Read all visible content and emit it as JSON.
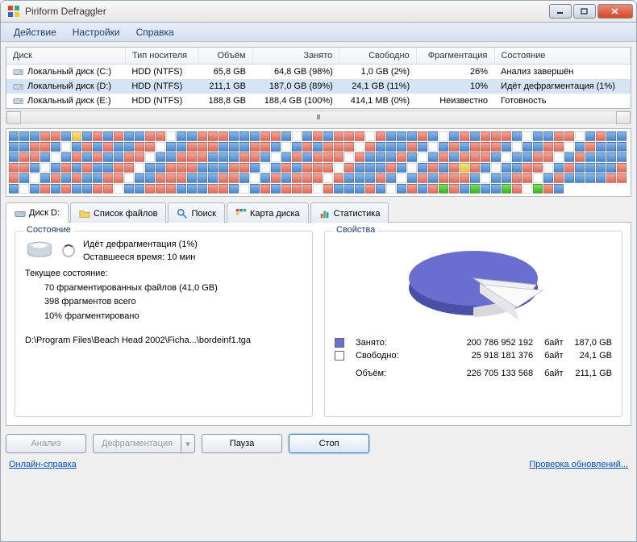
{
  "window": {
    "title": "Piriform Defraggler"
  },
  "menu": {
    "action": "Действие",
    "settings": "Настройки",
    "help": "Справка"
  },
  "disk_table": {
    "headers": {
      "disk": "Диск",
      "media": "Тип носителя",
      "size": "Объём",
      "used": "Занято",
      "free": "Свободно",
      "frag": "Фрагментация",
      "state": "Состояние"
    },
    "rows": [
      {
        "name": "Локальный диск (C:)",
        "media": "HDD (NTFS)",
        "size": "65,8 GB",
        "used": "64,8 GB (98%)",
        "free": "1,0 GB (2%)",
        "frag": "26%",
        "state": "Анализ завершён"
      },
      {
        "name": "Локальный диск (D:)",
        "media": "HDD (NTFS)",
        "size": "211,1 GB",
        "used": "187,0 GB (89%)",
        "free": "24,1 GB (11%)",
        "frag": "10%",
        "state": "Идёт дефрагментация (1%)"
      },
      {
        "name": "Локальный диск (E:)",
        "media": "HDD (NTFS)",
        "size": "188,8 GB",
        "used": "188,4 GB (100%)",
        "free": "414,1 MB (0%)",
        "frag": "Неизвестно",
        "state": "Готовность"
      }
    ]
  },
  "tabs": {
    "disk": "Диск D:",
    "file_list": "Список файлов",
    "search": "Поиск",
    "map": "Карта диска",
    "stats": "Статистика"
  },
  "status_panel": {
    "title": "Состояние",
    "running": "Идёт дефрагментация (1%)",
    "eta": "Оставшееся время: 10 мин",
    "current_label": "Текущее состояние:",
    "line1": "70  фрагментированных файлов (41,0 GB)",
    "line2": "398  фрагментов всего",
    "line3": "10%  фрагментировано",
    "filepath": "D:\\Program Files\\Beach Head 2002\\Ficha...\\bordeinf1.tga"
  },
  "props_panel": {
    "title": "Свойства",
    "used_label": "Занято:",
    "used_bytes": "200 786 952 192",
    "used_unit": "байт",
    "used_gb": "187,0 GB",
    "free_label": "Свободно:",
    "free_bytes": "25 918 181 376",
    "free_unit": "байт",
    "free_gb": "24,1 GB",
    "total_label": "Объём:",
    "total_bytes": "226 705 133 568",
    "total_unit": "байт",
    "total_gb": "211,1 GB"
  },
  "buttons": {
    "analyze": "Анализ",
    "defrag": "Дефрагментация",
    "pause": "Пауза",
    "stop": "Стоп"
  },
  "footer": {
    "online_help": "Онлайн-справка",
    "check_updates": "Проверка обновлений..."
  },
  "chart_data": {
    "type": "pie",
    "title": "Свойства",
    "series": [
      {
        "name": "Занято",
        "value": 200786952192,
        "unit": "байт",
        "label": "187,0 GB",
        "percent": 88.6,
        "color": "#6a6fcf"
      },
      {
        "name": "Свободно",
        "value": 25918181376,
        "unit": "байт",
        "label": "24,1 GB",
        "percent": 11.4,
        "color": "#ffffff"
      }
    ],
    "total": {
      "name": "Объём",
      "value": 226705133568,
      "unit": "байт",
      "label": "211,1 GB"
    }
  }
}
